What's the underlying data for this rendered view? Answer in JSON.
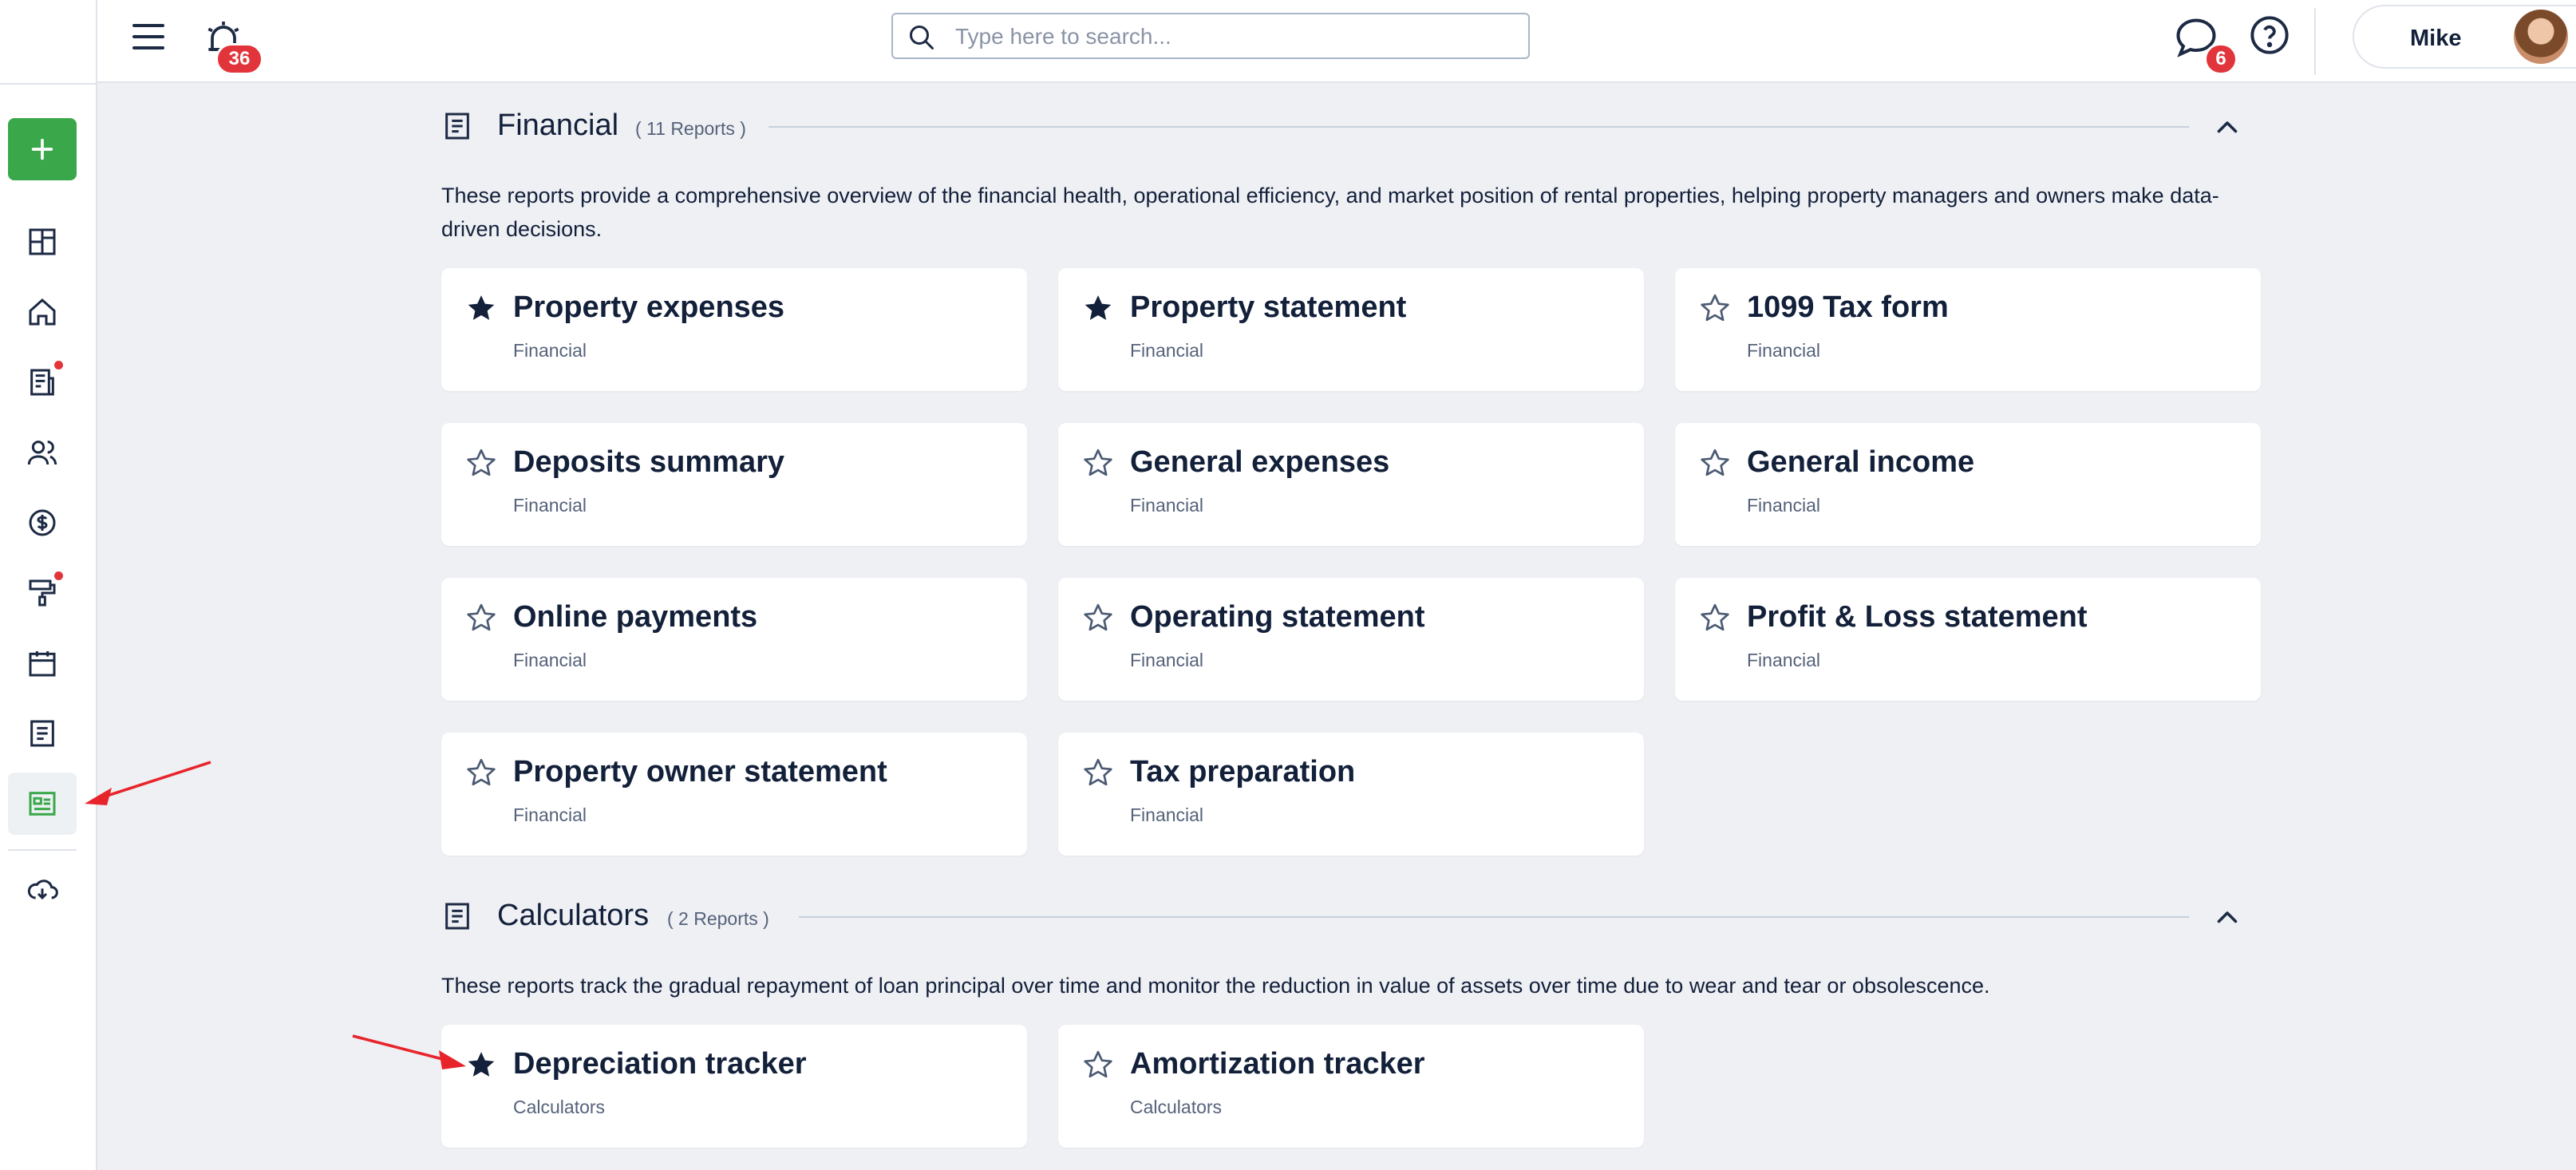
{
  "header": {
    "notifications_count": "36",
    "search_placeholder": "Type here to search...",
    "messages_count": "6",
    "user_name": "Mike"
  },
  "sections": [
    {
      "title": "Financial",
      "count": "( 11 Reports )",
      "description": "These reports provide a comprehensive overview of the financial health, operational efficiency, and market position of rental properties, helping property managers and owners make data-driven decisions.",
      "cards": [
        {
          "title": "Property expenses",
          "subtitle": "Financial",
          "favorite": true
        },
        {
          "title": "Property statement",
          "subtitle": "Financial",
          "favorite": true
        },
        {
          "title": "1099 Tax form",
          "subtitle": "Financial",
          "favorite": false
        },
        {
          "title": "Deposits summary",
          "subtitle": "Financial",
          "favorite": false
        },
        {
          "title": "General expenses",
          "subtitle": "Financial",
          "favorite": false
        },
        {
          "title": "General income",
          "subtitle": "Financial",
          "favorite": false
        },
        {
          "title": "Online payments",
          "subtitle": "Financial",
          "favorite": false
        },
        {
          "title": "Operating statement",
          "subtitle": "Financial",
          "favorite": false
        },
        {
          "title": "Profit & Loss statement",
          "subtitle": "Financial",
          "favorite": false
        },
        {
          "title": "Property owner statement",
          "subtitle": "Financial",
          "favorite": false
        },
        {
          "title": "Tax preparation",
          "subtitle": "Financial",
          "favorite": false
        }
      ]
    },
    {
      "title": "Calculators",
      "count": "( 2 Reports )",
      "description": "These reports track the gradual repayment of loan principal over time and monitor the reduction in value of assets over time due to wear and tear or obsolescence.",
      "cards": [
        {
          "title": "Depreciation tracker",
          "subtitle": "Calculators",
          "favorite": true
        },
        {
          "title": "Amortization tracker",
          "subtitle": "Calculators",
          "favorite": false
        }
      ]
    }
  ],
  "colors": {
    "accent_green": "#3aa84a",
    "badge_red": "#e1353b",
    "text_dark": "#13203a",
    "annotation_arrow": "#e8242b"
  }
}
